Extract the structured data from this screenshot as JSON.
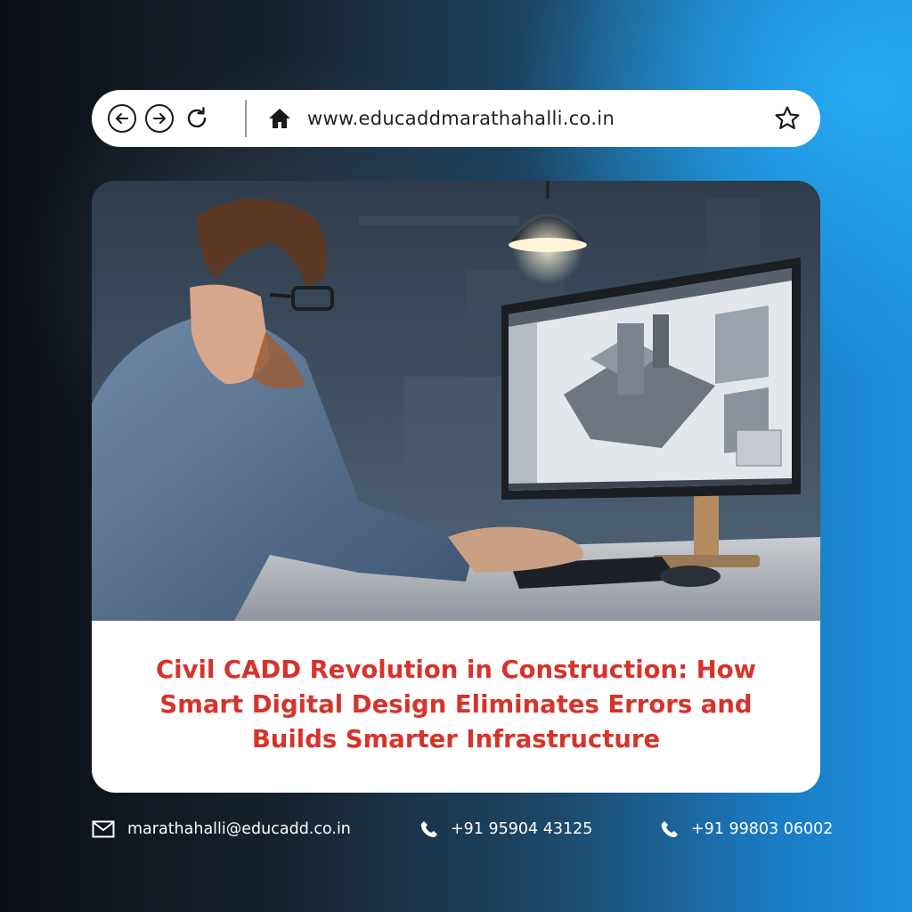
{
  "browser": {
    "url": "www.educaddmarathahalli.co.in"
  },
  "article": {
    "headline_lines": [
      "Civil CADD Revolution in Construction: How",
      "Smart Digital Design Eliminates Errors and",
      "Builds Smarter Infrastructure"
    ]
  },
  "contacts": {
    "email": "marathahalli@educadd.co.in",
    "phone1": "+91 95904 43125",
    "phone2": "+91 99803 06002"
  },
  "icons": [
    "back-arrow-icon",
    "forward-arrow-icon",
    "reload-icon",
    "home-icon",
    "star-icon",
    "mail-icon",
    "phone-icon"
  ],
  "colors": {
    "headline": "#d6332b",
    "accent_blue": "#1c8fde",
    "bar_background": "#ffffff"
  }
}
